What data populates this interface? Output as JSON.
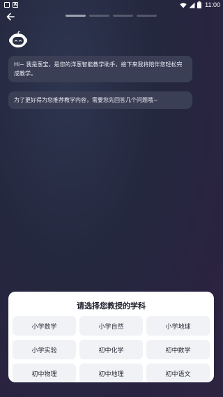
{
  "status_bar": {
    "time": "11:00",
    "left_icons": [
      "notification-box-icon",
      "notification-a-icon"
    ],
    "right_icons": [
      "wifi-icon",
      "signal-icon",
      "battery-icon"
    ]
  },
  "header": {
    "back_icon": "arrow-left-icon",
    "progress": {
      "total_steps": 4,
      "current_step": 1
    }
  },
  "chat": {
    "messages": [
      {
        "text": "Hi~ 我是葱宝，是您的洋葱智能教学助手，接下来我将陪伴您轻松完成教学。"
      },
      {
        "text": "为了更好得为您推荐教学内容，需要您先回答几个问题哦~"
      }
    ]
  },
  "sheet": {
    "title": "请选择您教授的学科",
    "subjects": [
      {
        "label": "小学数学"
      },
      {
        "label": "小学自然"
      },
      {
        "label": "小学地球"
      },
      {
        "label": "小学实验"
      },
      {
        "label": "初中化学"
      },
      {
        "label": "初中数学"
      },
      {
        "label": "初中物理"
      },
      {
        "label": "初中地理"
      },
      {
        "label": "初中语文"
      }
    ]
  },
  "colors": {
    "background": "#24283f",
    "bubble": "#3a3f56",
    "sheet": "#ffffff",
    "subject_button": "#f1f2f5"
  }
}
